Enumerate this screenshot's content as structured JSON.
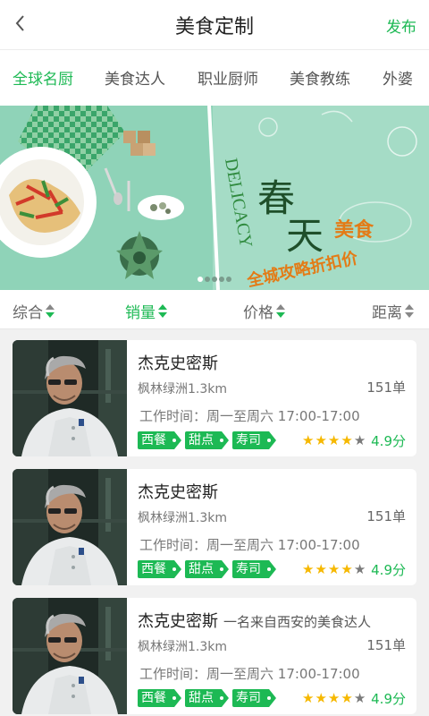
{
  "header": {
    "title": "美食定制",
    "publish_label": "发布"
  },
  "tabs": [
    {
      "label": "全球名厨",
      "active": true
    },
    {
      "label": "美食达人",
      "active": false
    },
    {
      "label": "职业厨师",
      "active": false
    },
    {
      "label": "美食教练",
      "active": false
    },
    {
      "label": "外婆",
      "active": false
    }
  ],
  "banner": {
    "word_delicacy": "DELICACY",
    "char_spring": "春",
    "char_day": "天",
    "food_text": "美食",
    "promo_text": "全城攻略折扣价",
    "page_count": 5,
    "active_page": 1
  },
  "sort": [
    {
      "label": "综合"
    },
    {
      "label": "销量"
    },
    {
      "label": "价格"
    },
    {
      "label": "距离"
    }
  ],
  "chefs": [
    {
      "name": "杰克史密斯",
      "subtitle": "",
      "location": "枫林绿洲1.3km",
      "orders": "151单",
      "hours": "工作时间：周一至周六   17:00-17:00",
      "tags": [
        "西餐",
        "甜点",
        "寿司"
      ],
      "stars": 4,
      "rating": "4.9分"
    },
    {
      "name": "杰克史密斯",
      "subtitle": "",
      "location": "枫林绿洲1.3km",
      "orders": "151单",
      "hours": "工作时间：周一至周六   17:00-17:00",
      "tags": [
        "西餐",
        "甜点",
        "寿司"
      ],
      "stars": 4,
      "rating": "4.9分"
    },
    {
      "name": "杰克史密斯",
      "subtitle": "一名来自西安的美食达人",
      "location": "枫林绿洲1.3km",
      "orders": "151单",
      "hours": "工作时间：周一至周六   17:00-17:00",
      "tags": [
        "西餐",
        "甜点",
        "寿司"
      ],
      "stars": 4,
      "rating": "4.9分"
    }
  ],
  "colors": {
    "accent": "#1db954",
    "banner_bg": "#8fd3b8",
    "star": "#f6b800"
  }
}
